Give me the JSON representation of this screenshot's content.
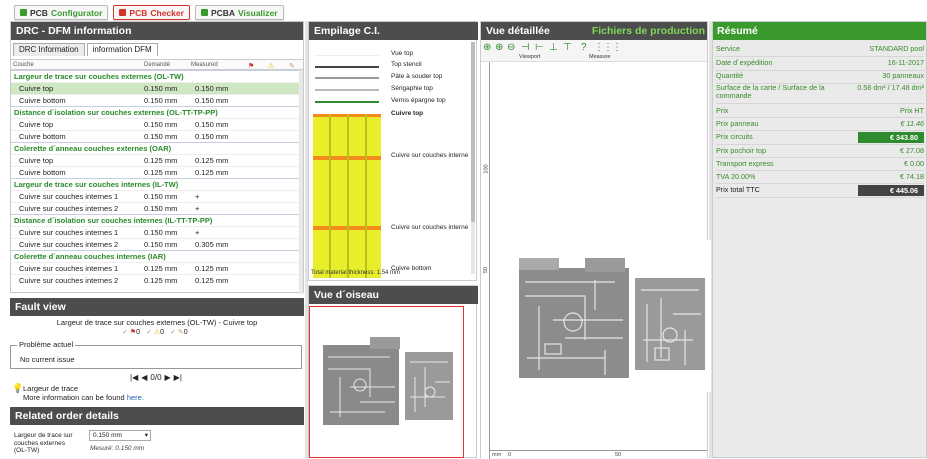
{
  "top_tabs": [
    {
      "prefix": "PCB",
      "name": "Configurator",
      "color": "#3a9a2e"
    },
    {
      "prefix": "PCB",
      "name": "Checker",
      "color": "#d6332b"
    },
    {
      "prefix": "PCBA",
      "name": "Visualizer",
      "color": "#3a9a2e"
    }
  ],
  "drc": {
    "title": "DRC - DFM information",
    "tabs": [
      "DRC Information",
      "information DFM"
    ],
    "columns": [
      "Couche",
      "Demandé",
      "Measured"
    ],
    "groups": [
      {
        "name": "Largeur de trace sur couches externes (OL-TW)",
        "rows": [
          [
            "Cuivre top",
            "0.150 mm",
            "0.150 mm"
          ],
          [
            "Cuivre bottom",
            "0.150 mm",
            "0.150 mm"
          ]
        ]
      },
      {
        "name": "Distance d´isolation sur couches externes (OL-TT-TP-PP)",
        "rows": [
          [
            "Cuivre top",
            "0.150 mm",
            "0.150 mm"
          ],
          [
            "Cuivre bottom",
            "0.150 mm",
            "0.150 mm"
          ]
        ]
      },
      {
        "name": "Colerette d´anneau couches externes (OAR)",
        "rows": [
          [
            "Cuivre top",
            "0.125 mm",
            "0.125 mm"
          ],
          [
            "Cuivre bottom",
            "0.125 mm",
            "0.125 mm"
          ]
        ]
      },
      {
        "name": "Largeur de trace sur couches internes (IL-TW)",
        "rows": [
          [
            "Cuivre sur couches internes 1",
            "0.150 mm",
            "+"
          ],
          [
            "Cuivre sur couches internes 2",
            "0.150 mm",
            "+"
          ]
        ]
      },
      {
        "name": "Distance d´isolation sur couches internes (IL-TT-TP-PP)",
        "rows": [
          [
            "Cuivre sur couches internes 1",
            "0.150 mm",
            "+"
          ],
          [
            "Cuivre sur couches internes 2",
            "0.150 mm",
            "0.305 mm"
          ]
        ]
      },
      {
        "name": "Colerette d´anneau couches internes (IAR)",
        "rows": [
          [
            "Cuivre sur couches internes 1",
            "0.125 mm",
            "0.125 mm"
          ],
          [
            "Cuivre sur couches internes 2",
            "0.125 mm",
            "0.125 mm"
          ]
        ]
      }
    ]
  },
  "fault": {
    "title": "Fault view",
    "current": "Largeur de trace sur couches externes (OL-TW) - Cuivre top",
    "counts": [
      "0",
      "0",
      "0"
    ],
    "legend": "Problème actuel",
    "issue": "No current issue",
    "pager": "0/0",
    "hint_title": "Largeur de trace",
    "hint_text": "More information can be found ",
    "hint_link": "here."
  },
  "related": {
    "title": "Related order details",
    "label": "Largeur de trace sur couches externes (OL-TW)",
    "select": "0.150 mm",
    "measured": "Mesuré: 0.150 mm"
  },
  "stack": {
    "title": "Empilage C.I.",
    "legend": [
      "Vue top",
      "Top stencil",
      "Pâte à souder top",
      "Sérigaphie top",
      "Vernis épargne top",
      "Cuivre top",
      "Cuivre sur couches interne",
      "Cuivre sur couches interne",
      "Cuivre bottom"
    ],
    "total": "Total material thickness: 1.54 mm"
  },
  "bird": {
    "title": "Vue d´oiseau"
  },
  "detail": {
    "title": "Vue détaillée",
    "production": "Fichiers de production",
    "viewport": "Viewport",
    "measure": "Measure",
    "ruler_v": [
      "100",
      "50"
    ],
    "ruler_h": [
      "mm",
      "0",
      "50"
    ]
  },
  "resume": {
    "title": "Résumé",
    "rows": [
      {
        "label": "Service",
        "value": "STANDARD pool"
      },
      {
        "label": "Date d´expédition",
        "value": "16-11-2017"
      },
      {
        "label": "Quantité",
        "value": "30 panneaux"
      },
      {
        "label": "Surface de la carte / Surface de la commande",
        "value": "0.58 dm² / 17.48 dm²"
      },
      {
        "label": "Prix",
        "value": "Prix HT"
      },
      {
        "label": "Prix panneau",
        "value": "€ 11.46"
      },
      {
        "label": "Prix circuits",
        "value": "€ 343.80"
      },
      {
        "label": "Prix pochoir top",
        "value": "€ 27.08"
      },
      {
        "label": "Transport express",
        "value": "€ 0.00"
      },
      {
        "label": "TVA 20.00%",
        "value": "€ 74.18"
      },
      {
        "label": "Prix total TTC",
        "value": "€ 445.06"
      }
    ]
  }
}
